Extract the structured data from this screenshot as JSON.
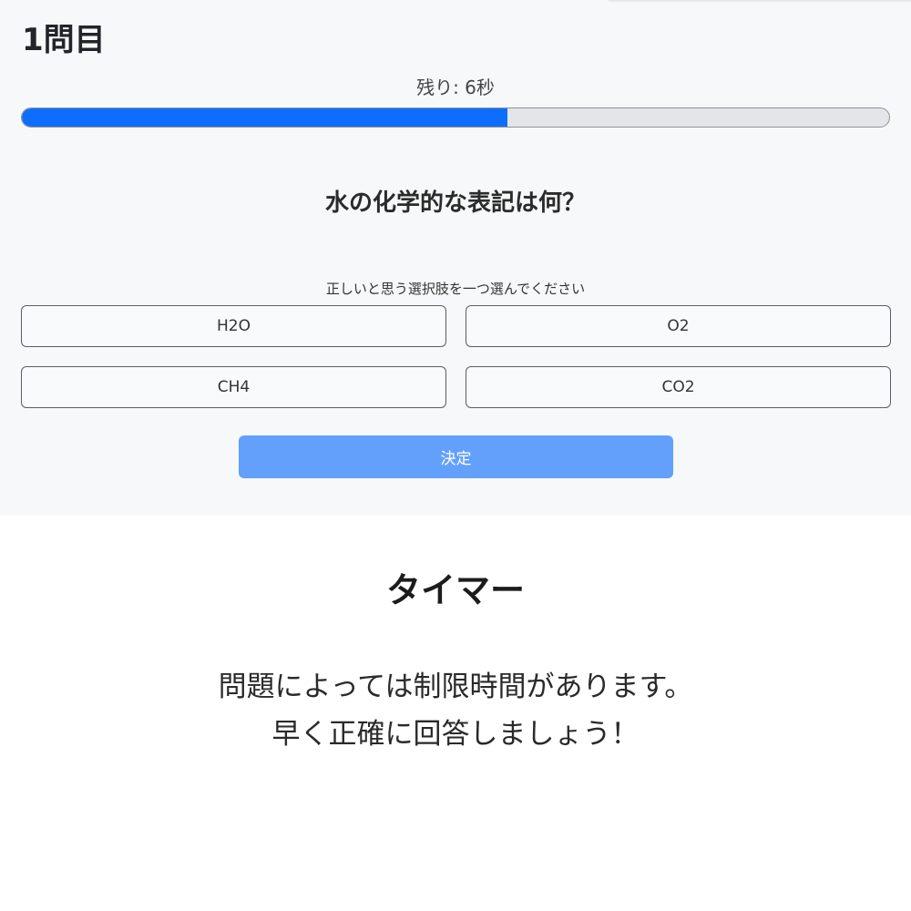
{
  "quiz": {
    "question_number": "1問目",
    "timer_text": "残り: 6秒",
    "timer_progress_fraction": 0.56,
    "progress_color": "#0d6efd",
    "question": "水の化学的な表記は何？",
    "instruction": "正しいと思う選択肢を一つ選んでください",
    "choices": [
      "H2O",
      "O2",
      "CH4",
      "CO2"
    ],
    "submit_label": "決定"
  },
  "feature": {
    "title": "タイマー",
    "description_lines": [
      "問題によっては制限時間があります。",
      "早く正確に回答しましょう！"
    ]
  }
}
